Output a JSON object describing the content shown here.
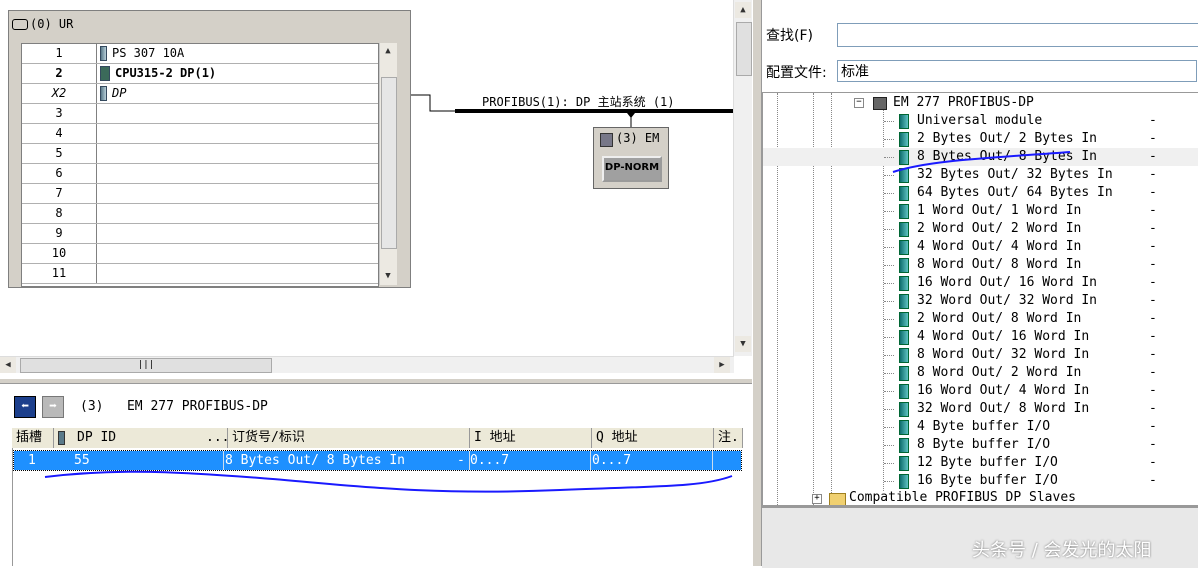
{
  "rack": {
    "title": "(0) UR",
    "rows": [
      {
        "slot": "1",
        "module": "PS 307 10A",
        "bold": false
      },
      {
        "slot": "2",
        "module": "CPU315-2 DP(1)",
        "bold": true
      },
      {
        "slot": "X2",
        "module": "DP",
        "bold": false
      },
      {
        "slot": "3",
        "module": ""
      },
      {
        "slot": "4",
        "module": ""
      },
      {
        "slot": "5",
        "module": ""
      },
      {
        "slot": "6",
        "module": ""
      },
      {
        "slot": "7",
        "module": ""
      },
      {
        "slot": "8",
        "module": ""
      },
      {
        "slot": "9",
        "module": ""
      },
      {
        "slot": "10",
        "module": ""
      },
      {
        "slot": "11",
        "module": ""
      }
    ]
  },
  "network": {
    "master_label": "PROFIBUS(1): DP 主站系统 (1)",
    "slave_title": "(3) EM",
    "slave_button": "DP-NORM"
  },
  "detail": {
    "station_no": "(3)",
    "station_name": "EM 277 PROFIBUS-DP",
    "headers": {
      "slot": "插槽",
      "dpid": "DP ID",
      "dots": "...",
      "order": "订货号/标识",
      "iaddr": "I 地址",
      "qaddr": "Q 地址",
      "comment": "注."
    },
    "row": {
      "slot": "1",
      "dpid": "55",
      "order": "8 Bytes Out/ 8 Bytes In",
      "dash": "-",
      "iaddr": "0...7",
      "qaddr": "0...7"
    }
  },
  "catalog": {
    "find_label": "查找(F)",
    "profile_label": "配置文件:",
    "profile_value": "标准",
    "parent": "EM 277 PROFIBUS-DP",
    "items": [
      "Universal module",
      "2 Bytes Out/ 2 Bytes In",
      "8 Bytes Out/ 8 Bytes In",
      "32 Bytes Out/ 32 Bytes In",
      "64 Bytes Out/ 64 Bytes In",
      "1 Word Out/ 1 Word In",
      "2 Word Out/ 2 Word In",
      "4 Word Out/ 4 Word In",
      "8 Word Out/ 8 Word In",
      "16 Word Out/ 16 Word In",
      "32 Word Out/ 32 Word In",
      "2 Word Out/ 8 Word In",
      "4 Word Out/ 16 Word In",
      "8 Word Out/ 32 Word In",
      "8 Word Out/ 2 Word In",
      "16 Word Out/ 4 Word In",
      "32 Word Out/ 8 Word In",
      "4 Byte buffer I/O",
      "8 Byte buffer I/O",
      "12 Byte buffer I/O",
      "16 Byte buffer I/O"
    ],
    "dash": "-",
    "next_folder": "Compatible PROFIBUS DP Slaves"
  },
  "watermark": "头条号 / 会发光的太阳",
  "colors": {
    "selection": "#1e90ff",
    "annotation": "#1a1aff"
  }
}
